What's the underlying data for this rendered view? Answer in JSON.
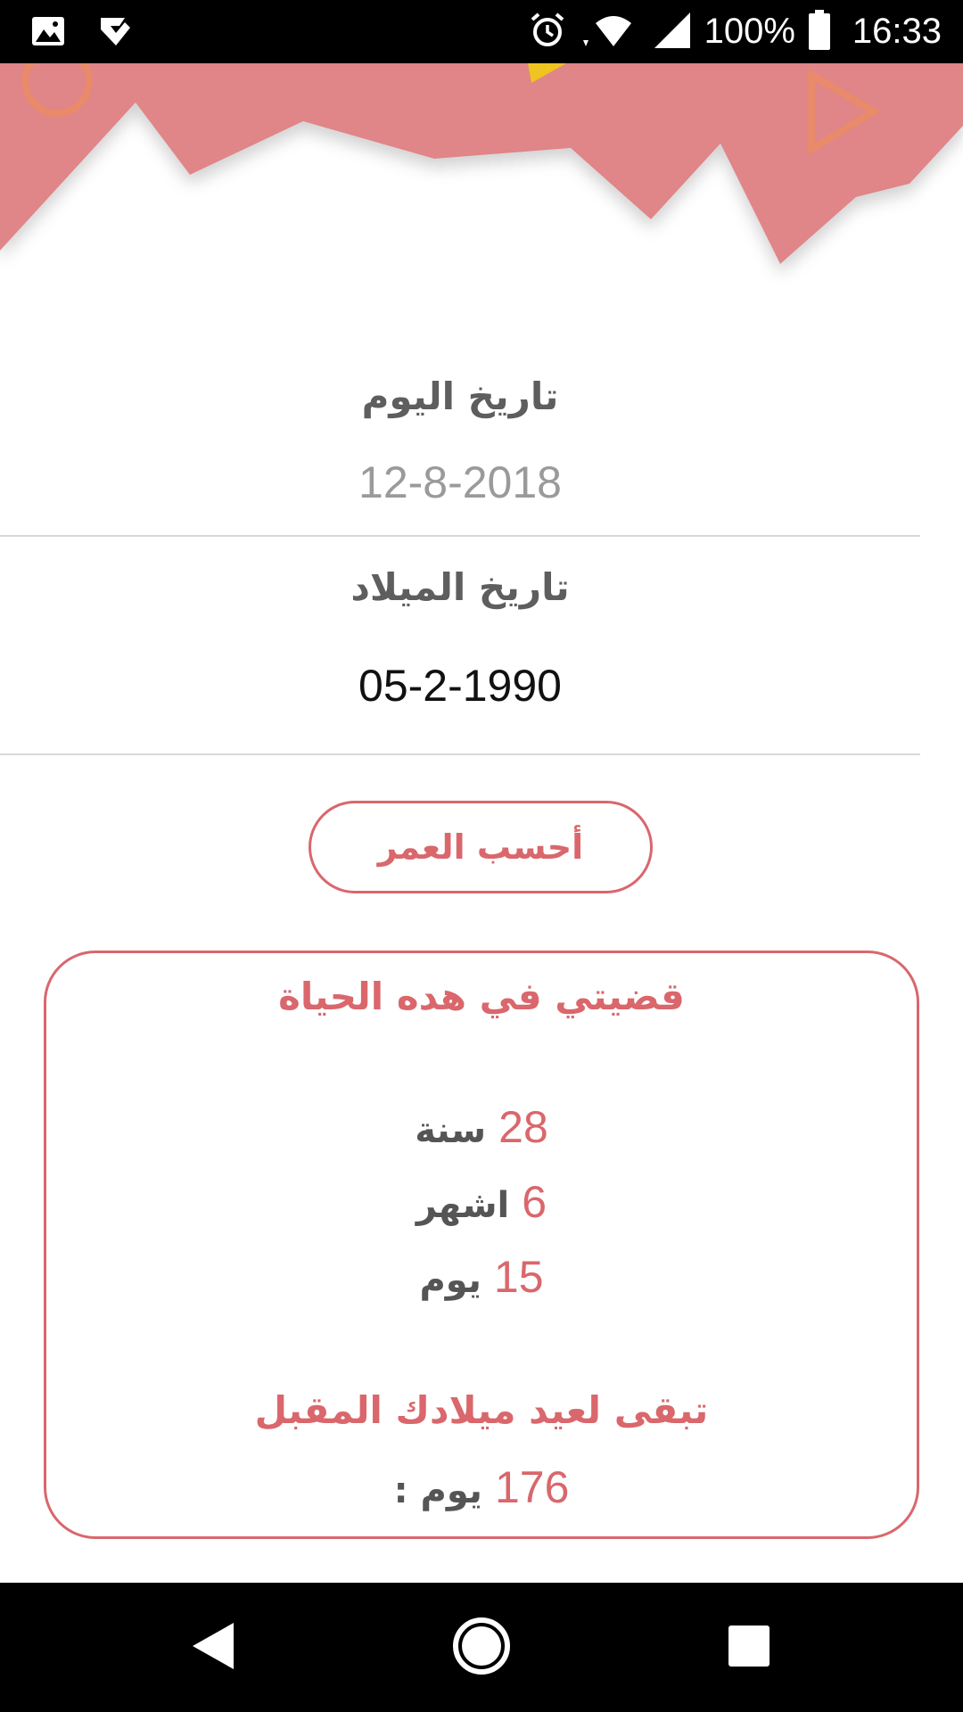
{
  "status_bar": {
    "battery": "100%",
    "time": "16:33",
    "icons": [
      "image-icon",
      "check-app-icon",
      "alarm-icon",
      "wifi-icon",
      "signal-icon",
      "battery-icon"
    ]
  },
  "today": {
    "label": "تاريخ اليوم",
    "value": "12-8-2018"
  },
  "birth": {
    "label": "تاريخ الميلاد",
    "value": "05-2-1990"
  },
  "calculate_button": {
    "label": "أحسب العمر"
  },
  "results": {
    "title": "قضيتي في هده الحياة",
    "years": {
      "value": "28",
      "unit": "سنة"
    },
    "months": {
      "value": "6",
      "unit": "اشهر"
    },
    "days": {
      "value": "15",
      "unit": "يوم"
    },
    "next_birthday_title": "تبقى لعيد ميلادك المقبل",
    "next_birthday": {
      "value": "176",
      "unit": ": يوم"
    }
  },
  "colors": {
    "accent": "#d9676c",
    "header_pink": "#e08588",
    "label_gray": "#5e5e5e"
  }
}
